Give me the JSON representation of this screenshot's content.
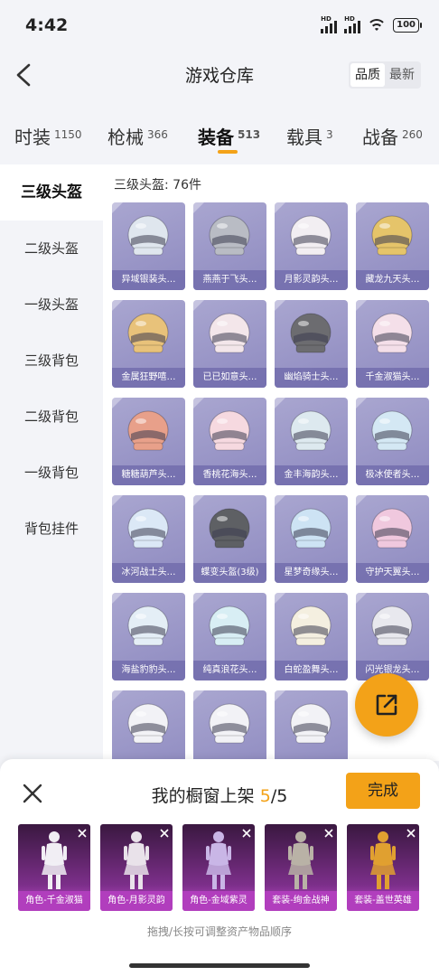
{
  "status_bar": {
    "time": "4:42",
    "battery": "100",
    "signal_label": "HD"
  },
  "header": {
    "title": "游戏仓库",
    "sort_options": [
      "品质",
      "最新"
    ]
  },
  "tabs": [
    {
      "label": "时装",
      "count": "1150"
    },
    {
      "label": "枪械",
      "count": "366"
    },
    {
      "label": "装备",
      "count": "513",
      "active": true
    },
    {
      "label": "载具",
      "count": "3"
    },
    {
      "label": "战备",
      "count": "260"
    }
  ],
  "sidebar": {
    "items": [
      "三级头盔",
      "二级头盔",
      "一级头盔",
      "三级背包",
      "二级背包",
      "一级背包",
      "背包挂件"
    ]
  },
  "content": {
    "section_title": "三级头盔: 76件",
    "items": [
      {
        "name": "异域银装头…",
        "color": "#dfe6ee"
      },
      {
        "name": "燕燕于飞头…",
        "color": "#b9bcc4"
      },
      {
        "name": "月影灵韵头…",
        "color": "#f2eef2"
      },
      {
        "name": "藏龙九天头…",
        "color": "#e5c46a"
      },
      {
        "name": "金属狂野嘻…",
        "color": "#e8c27a"
      },
      {
        "name": "已已如意头…",
        "color": "#f3e6ea"
      },
      {
        "name": "幽焰骑士头…",
        "color": "#6c6c70"
      },
      {
        "name": "千金淑猫头…",
        "color": "#f4dfe9"
      },
      {
        "name": "糖糖葫芦头…",
        "color": "#e8a08a"
      },
      {
        "name": "香桃花海头…",
        "color": "#f6d9e0"
      },
      {
        "name": "金丰海韵头…",
        "color": "#dde9ef"
      },
      {
        "name": "极冰使者头…",
        "color": "#d4e8f4"
      },
      {
        "name": "冰河战士头…",
        "color": "#dbe8f6"
      },
      {
        "name": "蝶变头盔(3级)",
        "color": "#5e6064"
      },
      {
        "name": "星梦奇缘头…",
        "color": "#cde3f4"
      },
      {
        "name": "守护天翼头…",
        "color": "#f0c8de"
      },
      {
        "name": "海盐豹豹头…",
        "color": "#e4eef6"
      },
      {
        "name": "纯真浪花头…",
        "color": "#d8eef4"
      },
      {
        "name": "白蛇盈舞头…",
        "color": "#f4efe0"
      },
      {
        "name": "闪光银龙头…",
        "color": "#e8e8ee"
      },
      {
        "name": "",
        "color": "#f2f2f6"
      },
      {
        "name": "",
        "color": "#f2f2f6"
      },
      {
        "name": "",
        "color": "#f2f2f6"
      }
    ]
  },
  "showcase": {
    "title_prefix": "我的橱窗上架",
    "count_current": "5",
    "count_total": "/5",
    "done_label": "完成",
    "items": [
      {
        "label": "角色-千金淑猫",
        "color": "#f1eef4"
      },
      {
        "label": "角色-月影灵韵",
        "color": "#e9e2ea"
      },
      {
        "label": "角色-金域紫灵",
        "color": "#c9b6e6"
      },
      {
        "label": "套装-绚金战神",
        "color": "#b9b2a6"
      },
      {
        "label": "套装-盖世英雄",
        "color": "#e0a030"
      }
    ],
    "hint": "拖拽/长按可调整资产物品顺序"
  },
  "colors": {
    "accent": "#f3a218",
    "card_bg": "#9a97c8",
    "showcase_bg": "#7c2f8a"
  }
}
